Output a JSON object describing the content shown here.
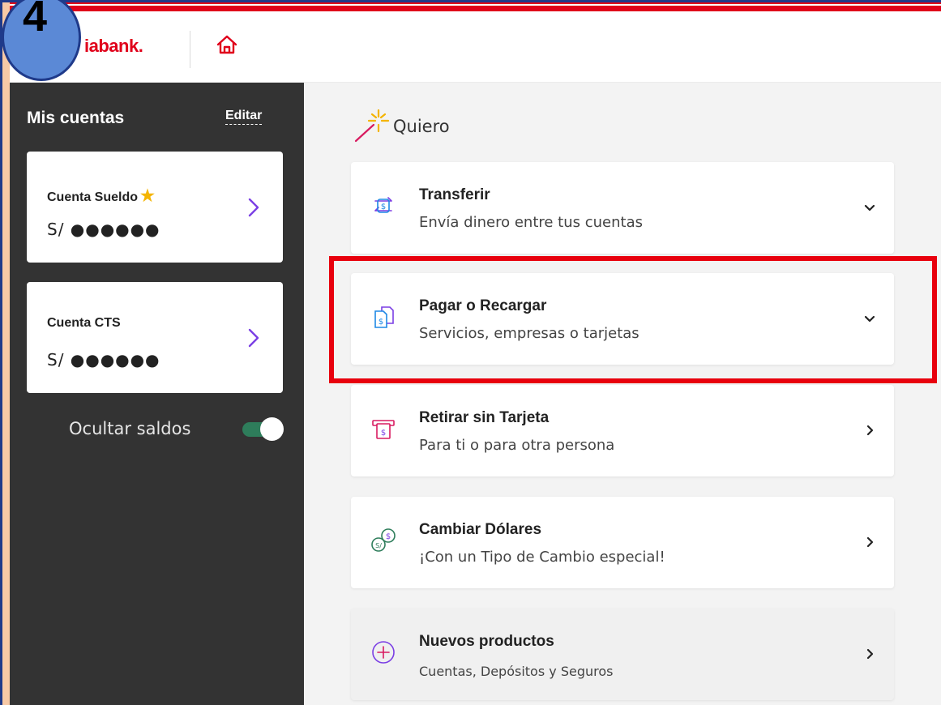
{
  "step_badge": "4",
  "header": {
    "logo_text": "iabank.",
    "home_icon": "home-icon"
  },
  "sidebar": {
    "title": "Mis cuentas",
    "edit_label": "Editar",
    "accounts": [
      {
        "name": "Cuenta Sueldo",
        "balance": "S/ ●●●●●●",
        "favorite": true
      },
      {
        "name": "Cuenta CTS",
        "balance": "S/ ●●●●●●",
        "favorite": false
      }
    ],
    "hide_balances_label": "Ocultar saldos",
    "hide_balances_on": true
  },
  "main": {
    "section_title": "Quiero",
    "options": [
      {
        "title": "Transferir",
        "subtitle": "Envía dinero entre tus cuentas",
        "icon": "transfer-icon",
        "arrow": "chevron-down"
      },
      {
        "title": "Pagar o Recargar",
        "subtitle": "Servicios, empresas o tarjetas",
        "icon": "pay-document-icon",
        "arrow": "chevron-down"
      },
      {
        "title": "Retirar sin Tarjeta",
        "subtitle": "Para ti o para otra persona",
        "icon": "atm-icon",
        "arrow": "chevron-right"
      },
      {
        "title": "Cambiar Dólares",
        "subtitle": "¡Con un Tipo de Cambio especial!",
        "icon": "currency-exchange-icon",
        "arrow": "chevron-right"
      },
      {
        "title": "Nuevos productos",
        "subtitle": "Cuentas, Depósitos y Seguros",
        "icon": "plus-circle-icon",
        "arrow": "chevron-right"
      }
    ]
  },
  "colors": {
    "brand_red": "#e0001a",
    "sidebar_bg": "#333333",
    "accent_purple": "#7b3fe4",
    "toggle_green": "#2e7d5b",
    "highlight_red": "#e8000d"
  }
}
